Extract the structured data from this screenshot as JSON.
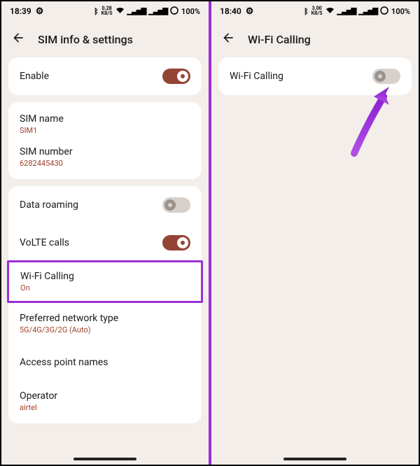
{
  "left": {
    "status": {
      "time": "18:39",
      "speed_top": "0.28",
      "speed_bot": "KB/S",
      "battery": "100%"
    },
    "header": {
      "title": "SIM info & settings"
    },
    "enable": {
      "label": "Enable"
    },
    "sim": {
      "name_label": "SIM name",
      "name_value": "SIM1",
      "num_label": "SIM number",
      "num_value": "6282445430"
    },
    "roaming": {
      "label": "Data roaming"
    },
    "volte": {
      "label": "VoLTE calls"
    },
    "wificall": {
      "label": "Wi-Fi Calling",
      "sub": "On"
    },
    "network": {
      "label": "Preferred network type",
      "sub": "5G/4G/3G/2G (Auto)"
    },
    "apn": {
      "label": "Access point names"
    },
    "operator": {
      "label": "Operator",
      "sub": "airtel"
    }
  },
  "right": {
    "status": {
      "time": "18:40",
      "speed_top": "3.00",
      "speed_bot": "KB/S",
      "battery": "100%"
    },
    "header": {
      "title": "Wi-Fi Calling"
    },
    "wificall": {
      "label": "Wi-Fi Calling"
    }
  }
}
